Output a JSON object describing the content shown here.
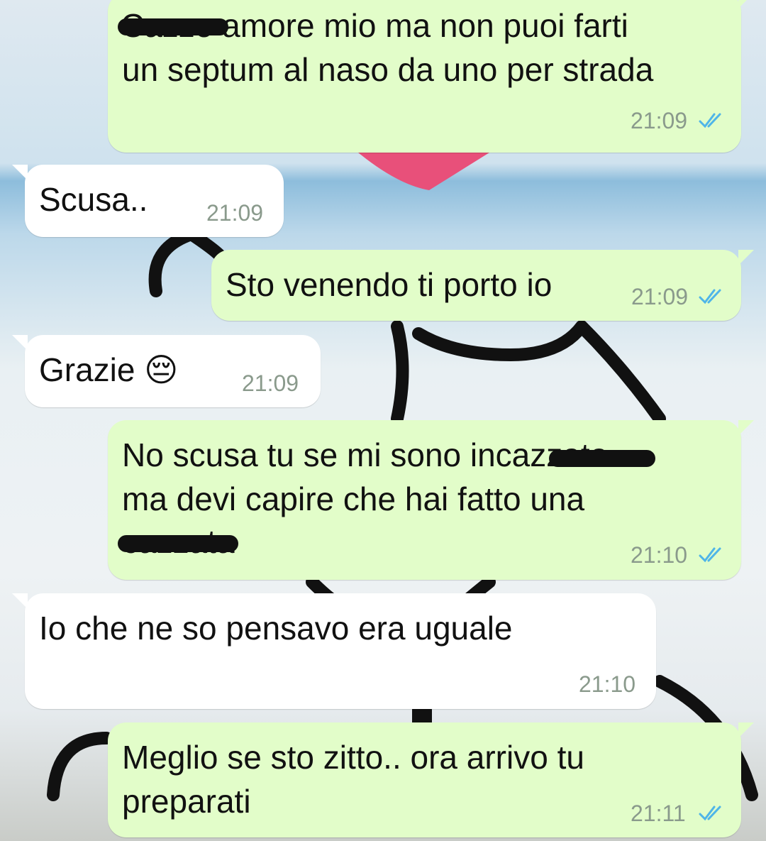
{
  "messages": [
    {
      "side": "out",
      "lines": [
        "Cazzo amore mio ma non puoi farti",
        "un septum al naso da uno per strada"
      ],
      "time": "21:09",
      "status_icon": "double-check-icon",
      "redacted": true
    },
    {
      "side": "in",
      "lines": [
        "Scusa.."
      ],
      "time": "21:09"
    },
    {
      "side": "out",
      "lines": [
        "Sto venendo ti porto io"
      ],
      "time": "21:09",
      "status_icon": "double-check-icon"
    },
    {
      "side": "in",
      "lines": [
        "Grazie 😔"
      ],
      "time": "21:09"
    },
    {
      "side": "out",
      "lines": [
        "No scusa tu se mi sono incazzato",
        "ma devi capire che hai fatto una",
        "cazzata"
      ],
      "time": "21:10",
      "status_icon": "double-check-icon",
      "redacted": true
    },
    {
      "side": "in",
      "lines": [
        "Io che ne so pensavo era uguale"
      ],
      "time": "21:10"
    },
    {
      "side": "out",
      "lines": [
        "Meglio se sto zitto.. ora arrivo tu",
        "preparati"
      ],
      "time": "21:11",
      "status_icon": "double-check-icon"
    }
  ],
  "colors": {
    "outgoing_bubble": "#e2fdc9",
    "incoming_bubble": "#ffffff",
    "read_ticks": "#4fb5e8",
    "timestamp": "#8a9a8c"
  }
}
